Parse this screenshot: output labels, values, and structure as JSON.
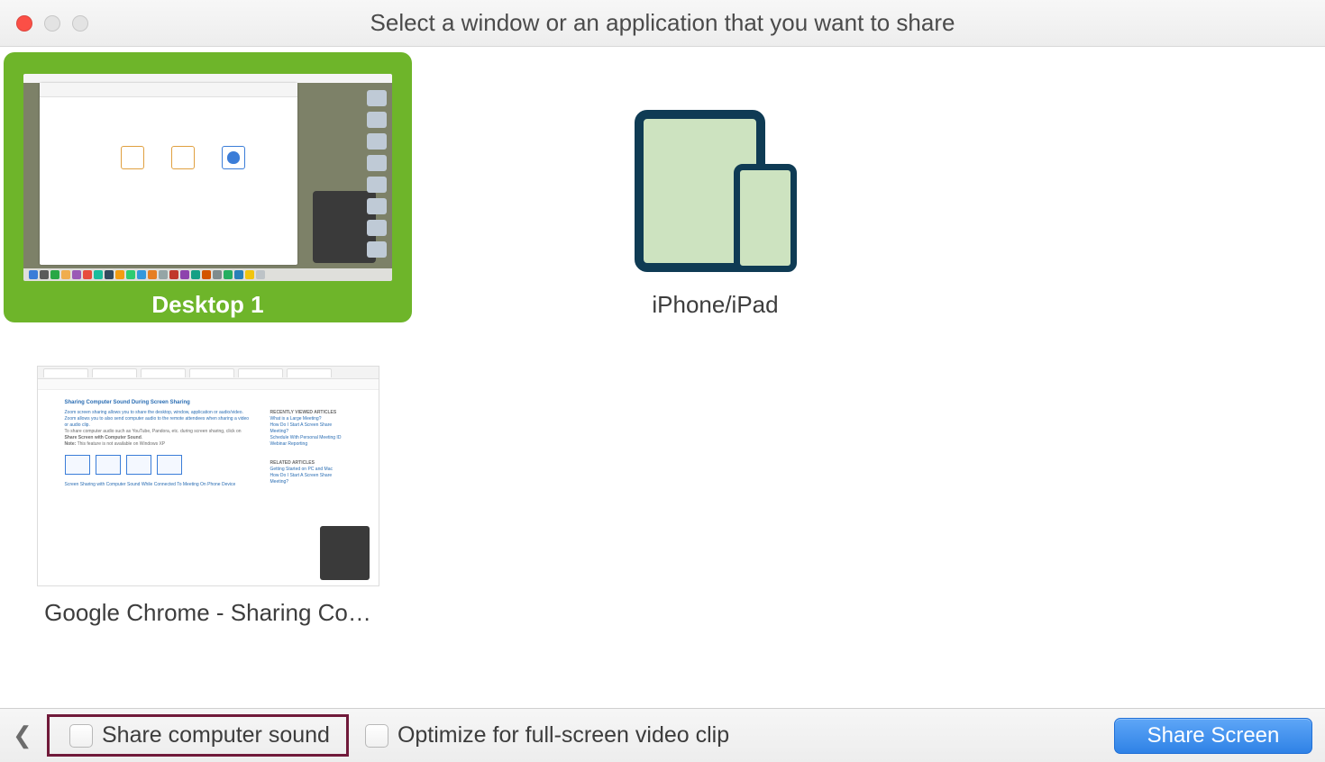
{
  "titlebar": {
    "title": "Select a window or an application that you want to share"
  },
  "options": {
    "desktop": {
      "label": "Desktop 1",
      "selected": true
    },
    "ios": {
      "label": "iPhone/iPad",
      "selected": false
    },
    "chrome": {
      "label": "Google Chrome - Sharing Co…",
      "selected": false
    }
  },
  "footer": {
    "share_sound_label": "Share computer sound",
    "share_sound_checked": false,
    "optimize_video_label": "Optimize for full-screen video clip",
    "optimize_video_checked": false,
    "share_button": "Share Screen"
  }
}
